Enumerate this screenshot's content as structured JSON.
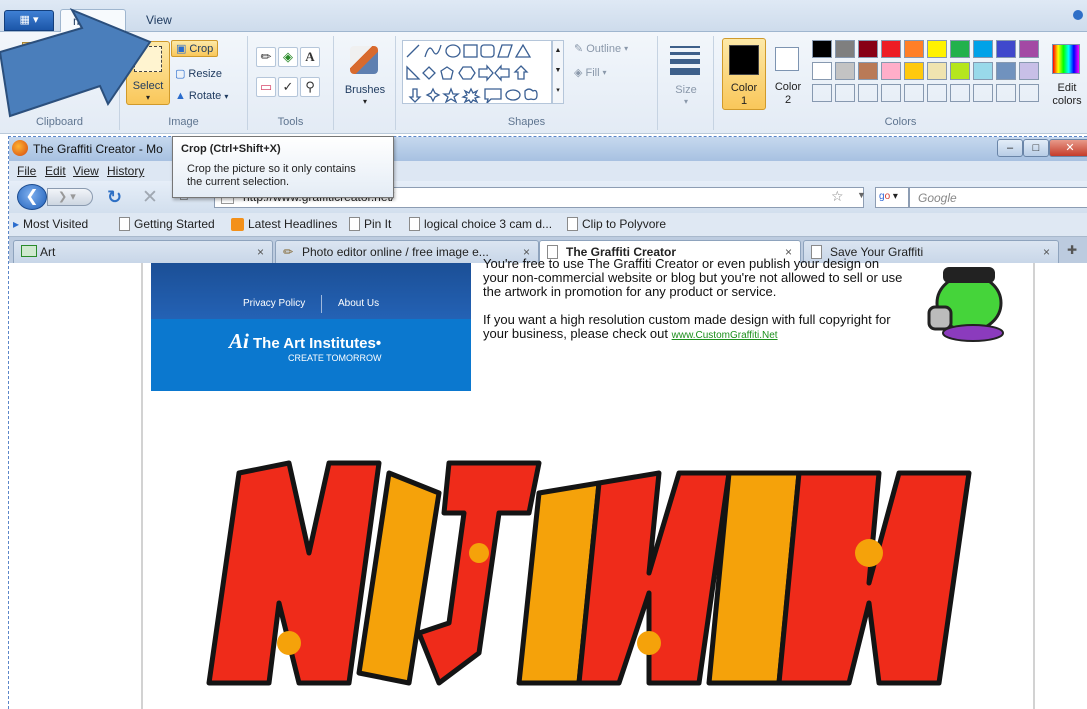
{
  "paint": {
    "tabs": {
      "home": "me",
      "view": "View"
    },
    "groups": {
      "clipboard": "Clipboard",
      "image": "Image",
      "tools": "Tools",
      "shapes": "Shapes",
      "colors": "Colors"
    },
    "image": {
      "select": "Select",
      "crop": "Crop",
      "resize": "Resize",
      "rotate": "Rotate"
    },
    "tools": {
      "text": "A"
    },
    "brushes": "Brushes",
    "shape_options": {
      "outline": "Outline",
      "fill": "Fill"
    },
    "size": "Size",
    "color1": {
      "line1": "Color",
      "line2": "1",
      "value": "#000000"
    },
    "color2": {
      "line1": "Color",
      "line2": "2",
      "value": "#ffffff"
    },
    "edit_colors": {
      "line1": "Edit",
      "line2": "colors"
    },
    "palette_row1": [
      "#000000",
      "#7f7f7f",
      "#880015",
      "#ed1c24",
      "#ff7f27",
      "#fff200",
      "#22b14c",
      "#00a2e8",
      "#3f48cc",
      "#a349a4"
    ],
    "palette_row2": [
      "#ffffff",
      "#c3c3c3",
      "#b97a57",
      "#ffaec9",
      "#ffc90e",
      "#efe4b0",
      "#b5e61d",
      "#99d9ea",
      "#7092be",
      "#c8bfe7"
    ]
  },
  "tooltip": {
    "title": "Crop (Ctrl+Shift+X)",
    "body_line1": "Crop the picture so it only contains",
    "body_line2": "the current selection."
  },
  "browser": {
    "title": "The Graffiti Creator - Mo",
    "menu": [
      "File",
      "Edit",
      "View",
      "History"
    ],
    "url": "http://www.graffiticreator.net/",
    "search_placeholder": "Google",
    "bookmarks": [
      "Most Visited",
      "Getting Started",
      "Latest Headlines",
      "Pin It",
      "logical choice 3 cam d...",
      "Clip to Polyvore"
    ],
    "tabs": [
      {
        "label": "Art"
      },
      {
        "label": "Photo editor online / free image e..."
      },
      {
        "label": "The Graffiti Creator"
      },
      {
        "label": "Save Your Graffiti"
      }
    ]
  },
  "page": {
    "ad_privacy": "Privacy Policy",
    "ad_about": "About Us",
    "ad_brand_ai": "Ai",
    "ad_brand": "The Art Institutes",
    "ad_tagline": "CREATE TOMORROW",
    "desc1": "You're free to use The Graffiti Creator or even publish your design on your non-commercial website or blog but you're not allowed to sell or use the artwork in promotion for any product or service.",
    "desc2": "If you want a high resolution custom made design with full copyright for your business, please check out",
    "desc_link": "www.CustomGraffiti.Net"
  }
}
